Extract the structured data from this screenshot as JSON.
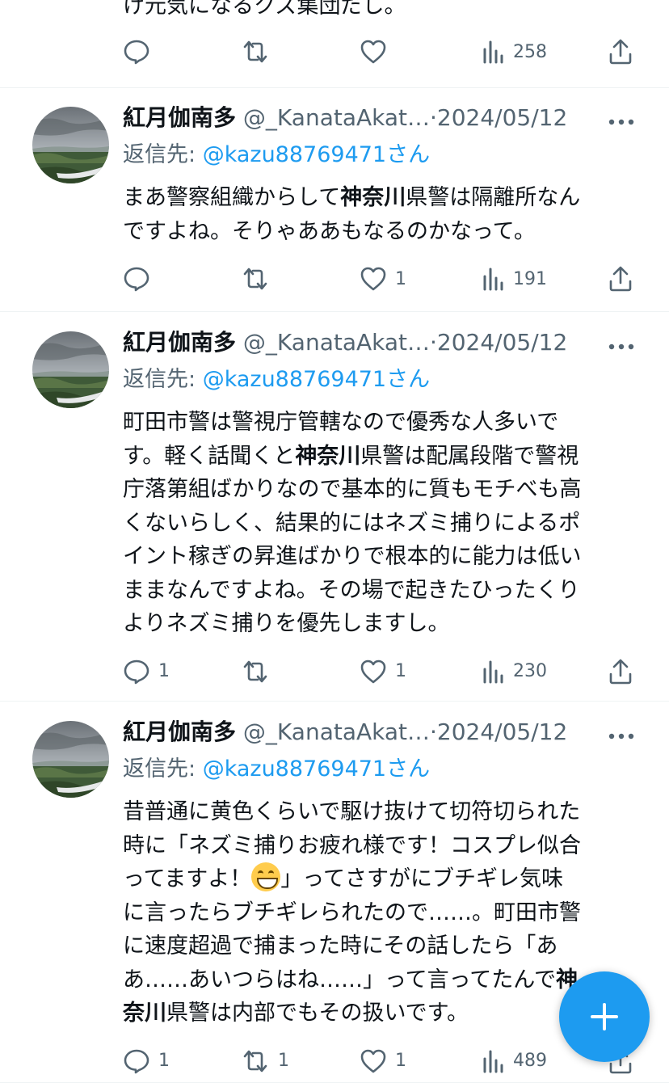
{
  "colors": {
    "accent": "#1d9bf0",
    "muted": "#536471",
    "text": "#0f1419",
    "divider": "#eff3f4"
  },
  "top_tweet": {
    "partial_text": "け元気になるクズ集団だし。",
    "stats": {
      "replies": "",
      "retweets": "",
      "likes": "",
      "views": "258"
    }
  },
  "tweets": [
    {
      "name": "紅月伽南多",
      "handle": "@_KanataAkat…",
      "separator": "·",
      "date": "2024/05/12",
      "reply_prefix": "返信先: ",
      "reply_mention": "@kazu88769471さん",
      "lines": [
        [
          {
            "t": "まあ警察組織からして"
          },
          {
            "t": "神奈川",
            "b": true
          },
          {
            "t": "県警は隔離所なん"
          }
        ],
        [
          {
            "t": "ですよね。そりゃああもなるのかなって。"
          }
        ]
      ],
      "stats": {
        "replies": "",
        "retweets": "",
        "likes": "1",
        "views": "191"
      }
    },
    {
      "name": "紅月伽南多",
      "handle": "@_KanataAkat…",
      "separator": "·",
      "date": "2024/05/12",
      "reply_prefix": "返信先: ",
      "reply_mention": "@kazu88769471さん",
      "lines": [
        [
          {
            "t": "町田市警は警視庁管轄なので優秀な人多いで"
          }
        ],
        [
          {
            "t": "す。軽く話聞くと"
          },
          {
            "t": "神奈川",
            "b": true
          },
          {
            "t": "県警は配属段階で警視"
          }
        ],
        [
          {
            "t": "庁落第組ばかりなので基本的に質もモチべも高"
          }
        ],
        [
          {
            "t": "くないらしく、結果的にはネズミ捕りによるポ"
          }
        ],
        [
          {
            "t": "イント稼ぎの昇進ばかりで根本的に能力は低い"
          }
        ],
        [
          {
            "t": "ままなんですよね。その場で起きたひったくり"
          }
        ],
        [
          {
            "t": "よりネズミ捕りを優先しますし。"
          }
        ]
      ],
      "stats": {
        "replies": "1",
        "retweets": "",
        "likes": "1",
        "views": "230"
      }
    },
    {
      "name": "紅月伽南多",
      "handle": "@_KanataAkat…",
      "separator": "·",
      "date": "2024/05/12",
      "reply_prefix": "返信先: ",
      "reply_mention": "@kazu88769471さん",
      "lines": [
        [
          {
            "t": "昔普通に黄色くらいで駆け抜けて切符切られた"
          }
        ],
        [
          {
            "t": "時に「ネズミ捕りお疲れ様です！コスプレ似合"
          }
        ],
        [
          {
            "t": "ってますよ！"
          },
          {
            "emoji": "grinning-face"
          },
          {
            "t": "」ってさすがにブチギレ気味"
          }
        ],
        [
          {
            "t": "に言ったらブチギレられたので……。町田市警"
          }
        ],
        [
          {
            "t": "に速度超過で捕まった時にその話したら「あ"
          }
        ],
        [
          {
            "t": "あ……あいつらはね……」って言ってたんで"
          },
          {
            "t": "神",
            "b": true
          }
        ],
        [
          {
            "t": "奈川",
            "b": true
          },
          {
            "t": "県警は内部でもその扱いです。"
          }
        ]
      ],
      "stats": {
        "replies": "1",
        "retweets": "1",
        "likes": "1",
        "views": "489"
      }
    }
  ],
  "fab": {
    "icon": "plus-icon"
  }
}
